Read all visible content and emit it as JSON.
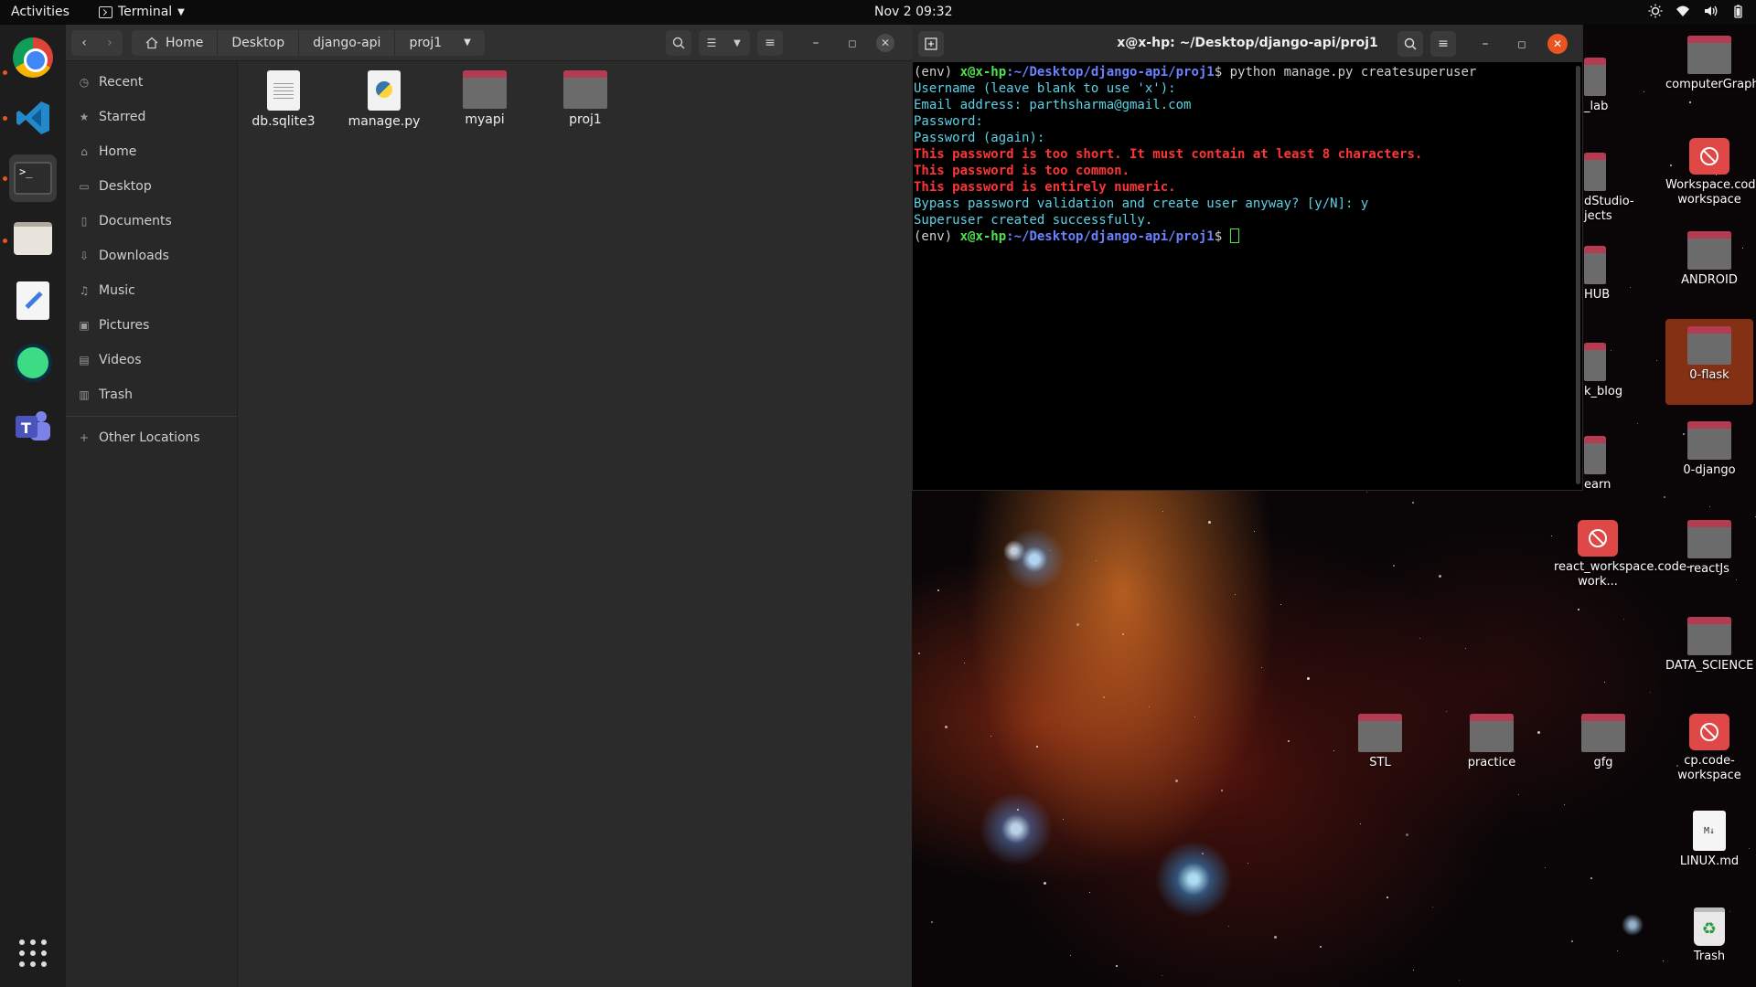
{
  "topbar": {
    "activities": "Activities",
    "app_name": "Terminal",
    "clock": "Nov 2  09:32"
  },
  "file_manager": {
    "breadcrumbs": [
      "Home",
      "Desktop",
      "django-api",
      "proj1"
    ],
    "sidebar": [
      {
        "label": "Recent",
        "icon": "clock-icon"
      },
      {
        "label": "Starred",
        "icon": "star-icon"
      },
      {
        "label": "Home",
        "icon": "home-icon"
      },
      {
        "label": "Desktop",
        "icon": "desktop-icon"
      },
      {
        "label": "Documents",
        "icon": "documents-icon"
      },
      {
        "label": "Downloads",
        "icon": "downloads-icon"
      },
      {
        "label": "Music",
        "icon": "music-icon"
      },
      {
        "label": "Pictures",
        "icon": "pictures-icon"
      },
      {
        "label": "Videos",
        "icon": "videos-icon"
      },
      {
        "label": "Trash",
        "icon": "trash-icon"
      }
    ],
    "other_locations": "Other Locations",
    "files": [
      {
        "name": "db.sqlite3",
        "type": "document"
      },
      {
        "name": "manage.py",
        "type": "python"
      },
      {
        "name": "myapi",
        "type": "folder"
      },
      {
        "name": "proj1",
        "type": "folder"
      }
    ]
  },
  "terminal": {
    "title": "x@x-hp: ~/Desktop/django-api/proj1",
    "env": "(env) ",
    "user_host": "x@x-hp",
    "path": ":~/Desktop/django-api/proj1",
    "prompt_end": "$ ",
    "command": "python manage.py createsuperuser",
    "line_username": "Username (leave blank to use 'x'):",
    "line_email": "Email address: parthsharma@gmail.com",
    "line_password": "Password:",
    "line_password_again": "Password (again):",
    "error_short": "This password is too short. It must contain at least 8 characters.",
    "error_common": "This password is too common.",
    "error_numeric": "This password is entirely numeric.",
    "line_bypass": "Bypass password validation and create user anyway? [y/N]: y",
    "line_success": "Superuser created successfully."
  },
  "desktop": {
    "icons": [
      {
        "label": "computerGraphics",
        "type": "folder"
      },
      {
        "label": "Workspace.code-workspace",
        "type": "blocked"
      },
      {
        "label": "ANDROID",
        "type": "folder"
      },
      {
        "label": "0-flask",
        "type": "folder"
      },
      {
        "label": "0-django",
        "type": "folder"
      },
      {
        "label": "react_workspace.code-work...",
        "type": "blocked"
      },
      {
        "label": "reactJs",
        "type": "folder"
      },
      {
        "label": "DATA_SCIENCE",
        "type": "folder"
      },
      {
        "label": "STL",
        "type": "folder"
      },
      {
        "label": "practice",
        "type": "folder"
      },
      {
        "label": "gfg",
        "type": "folder"
      },
      {
        "label": "cp.code-workspace",
        "type": "blocked"
      },
      {
        "label": "LINUX.md",
        "type": "markdown"
      },
      {
        "label": "Trash",
        "type": "trash"
      }
    ],
    "partial_labels": [
      "_lab",
      "dStudio-\njects",
      "HUB",
      "k_blog",
      "earn"
    ],
    "md_badge": "M↓",
    "accent": "#e95420"
  }
}
